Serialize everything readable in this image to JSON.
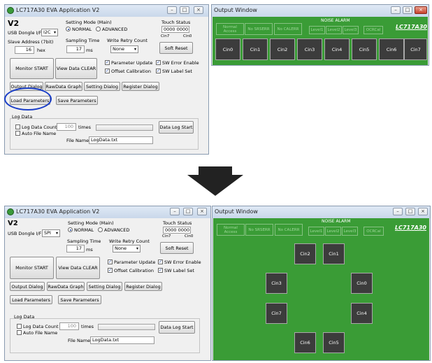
{
  "app": {
    "title": "LC717A30 EVA Application V2",
    "version_label": "V2",
    "usb_label": "USB Dongle I/F",
    "usb_value_top": "I2C",
    "usb_value_bottom": "SPI",
    "slave_label": "Slave Address (7bit)",
    "slave_value": "16",
    "slave_unit": "hex",
    "setting_mode_label": "Setting Mode (Main)",
    "mode_normal": "NORMAL",
    "mode_advanced": "ADVANCED",
    "sampling_label": "Sampling Time",
    "sampling_value": "17",
    "sampling_unit": "ms",
    "retry_label": "Write Retry Count",
    "retry_value": "None",
    "touch_label": "Touch Status",
    "touch_value": "0000 0000",
    "cin7": "Cin7",
    "cin0": "Cin0",
    "soft_reset": "Soft Reset",
    "monitor_start": "Monitor START",
    "view_clear": "View Data CLEAR",
    "param_update": "Parameter Update",
    "offset_cal": "Offset Calibration",
    "sw_error": "SW Error Enable",
    "sw_label": "SW Label Set",
    "output_dialog": "Output Dialog",
    "rawdata_graph": "RawData Graph",
    "setting_dialog": "Setting Dialog",
    "register_dialog": "Register Dialog",
    "load_params": "Load Parameters",
    "save_params": "Save Parameters",
    "log_data_title": "Log Data",
    "log_count": "Log Data Count",
    "auto_file": "Auto File Name",
    "times_value": "100",
    "times_label": "times",
    "log_start": "Data Log Start",
    "file_name_label": "File Name",
    "file_name_value": "LogData.txt"
  },
  "output": {
    "title": "Output Window",
    "noise_alarm": "NOISE ALARM",
    "normal_access": "Normal Access",
    "no_sreset": "No SRSERR",
    "no_calerr": "No CALERR",
    "level1": "Level1",
    "level2": "Level2",
    "level3": "Level3",
    "ocrcal": "OCRCal",
    "brand": "LC717A30",
    "cins": [
      "Cin0",
      "Cin1",
      "Cin2",
      "Cin3",
      "Cin4",
      "Cin5",
      "Cin6",
      "Cin7"
    ]
  },
  "arrow": {
    "direction": "down"
  },
  "colors": {
    "panel_green": "#3a9c36",
    "highlight_oval": "#1a3ec8"
  }
}
